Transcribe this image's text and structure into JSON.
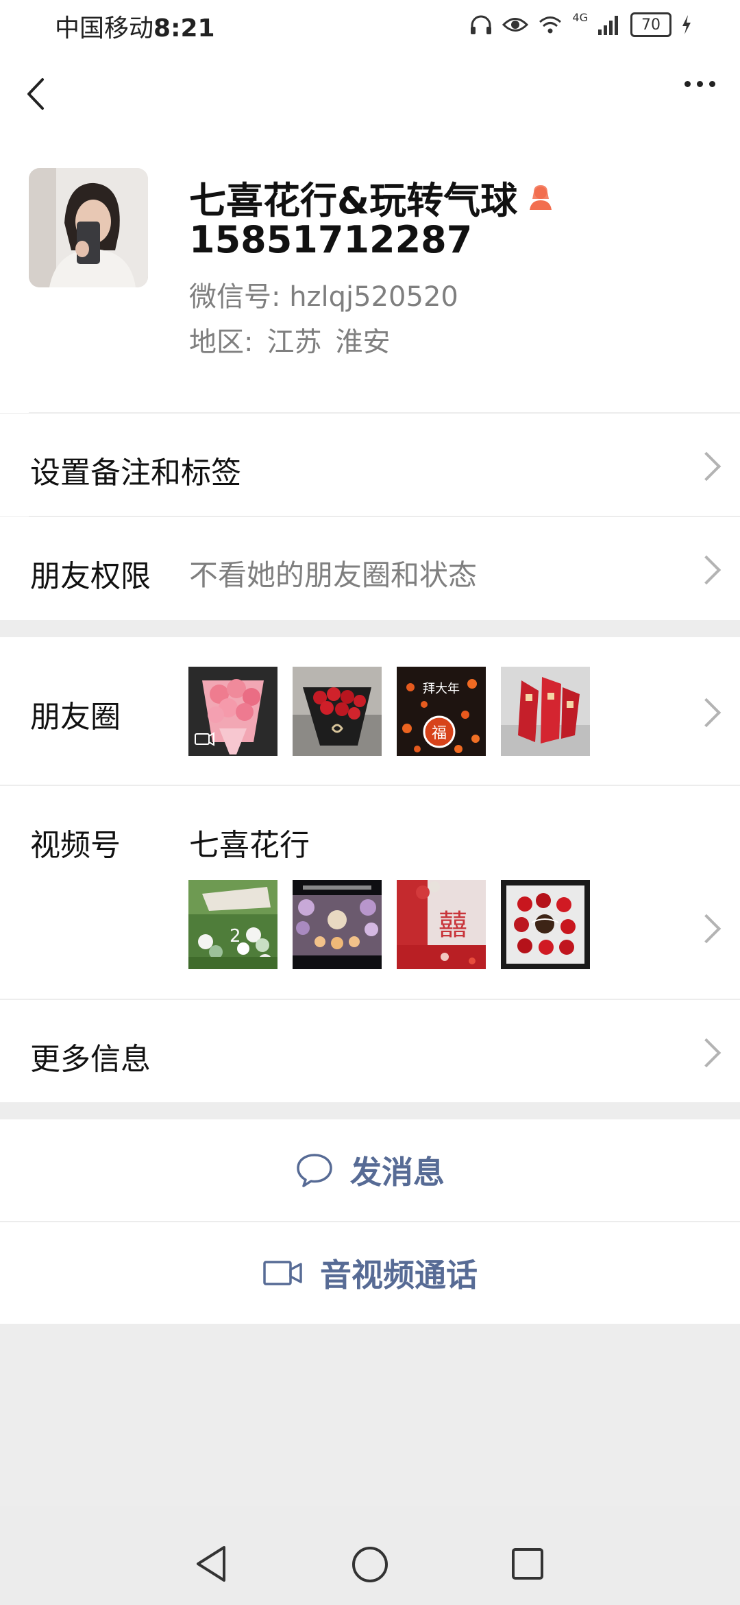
{
  "status_bar": {
    "carrier": "中国移动",
    "time": "8:21",
    "network": "4G",
    "battery": "70"
  },
  "profile": {
    "name": "七喜花行&玩转气球",
    "phone": "15851712287",
    "wechat_id": "微信号: hzlqj520520",
    "region_label": "地区:",
    "region_province": "江苏",
    "region_city": "淮安"
  },
  "rows": {
    "remark": "设置备注和标签",
    "permissions_label": "朋友权限",
    "permissions_value": "不看她的朋友圈和状态",
    "moments_label": "朋友圈",
    "channels_label": "视频号",
    "channels_name": "七喜花行",
    "more_info": "更多信息"
  },
  "moments_thumbs": [
    "pink-bouquet",
    "red-rose-bouquet",
    "new-year-poster",
    "red-couplets-display"
  ],
  "moments_thumb_texts": [
    "拜大年",
    "福"
  ],
  "channels_thumbs": [
    "balloon-garden",
    "balloon-stage",
    "red-wedding",
    "strawberry-box"
  ],
  "channels_thumb_texts": [
    "囍"
  ],
  "actions": {
    "message": "发消息",
    "call": "音视频通话"
  },
  "colors": {
    "link": "#576b95",
    "secondary_text": "#7f7f7f",
    "badge": "#f26e4f"
  }
}
